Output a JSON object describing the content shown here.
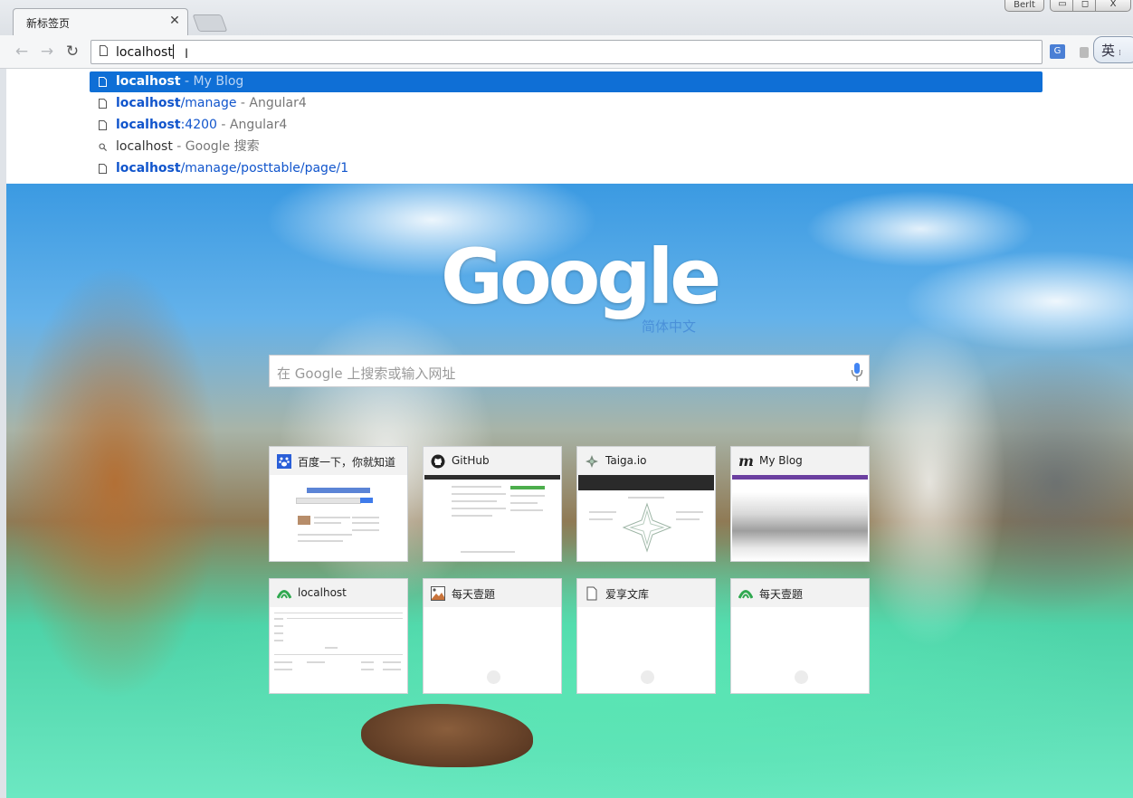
{
  "tabs": [
    {
      "title": "新标签页",
      "active": true
    }
  ],
  "window": {
    "user": "Berlt",
    "minimize": "▭",
    "maximize": "□",
    "close": "X"
  },
  "toolbar": {
    "back": "←",
    "forward": "→",
    "reload": "↻",
    "omnibox_value": "localhost",
    "ime_label": "英"
  },
  "suggestions": [
    {
      "host": "localhost",
      "path": "",
      "sep": " - ",
      "desc": "My Blog",
      "icon": "page-icon",
      "selected": true
    },
    {
      "host": "localhost",
      "path": "/manage",
      "sep": " - ",
      "desc": "Angular4",
      "icon": "page-icon",
      "selected": false
    },
    {
      "host": "localhost",
      "path": ":4200",
      "sep": " - ",
      "desc": "Angular4",
      "icon": "page-icon",
      "selected": false
    },
    {
      "plain": "localhost",
      "sep": " - ",
      "desc": "Google 搜索",
      "icon": "search-icon",
      "selected": false
    },
    {
      "host": "localhost",
      "path": "/manage/posttable/page/1",
      "sep": "",
      "desc": "",
      "icon": "page-icon",
      "selected": false
    }
  ],
  "ntp": {
    "logo": "Google",
    "logo_sub": "简体中文",
    "search_placeholder": "在 Google 上搜索或输入网址",
    "tiles": [
      {
        "title": "百度一下，你就知道",
        "favicon": "baidu-icon"
      },
      {
        "title": "GitHub",
        "favicon": "github-icon"
      },
      {
        "title": "Taiga.io",
        "favicon": "taiga-icon"
      },
      {
        "title": "My Blog",
        "favicon": "m-logo-icon"
      },
      {
        "title": "localhost",
        "favicon": "angular-green-icon"
      },
      {
        "title": "每天壹題",
        "favicon": "image-icon"
      },
      {
        "title": "爱享文库",
        "favicon": "page-icon"
      },
      {
        "title": "每天壹題",
        "favicon": "angular-green-icon"
      }
    ]
  },
  "colors": {
    "selected_row": "#0f6fd6",
    "url_blue": "#1155cc",
    "logo_sub": "#4a90d9"
  }
}
